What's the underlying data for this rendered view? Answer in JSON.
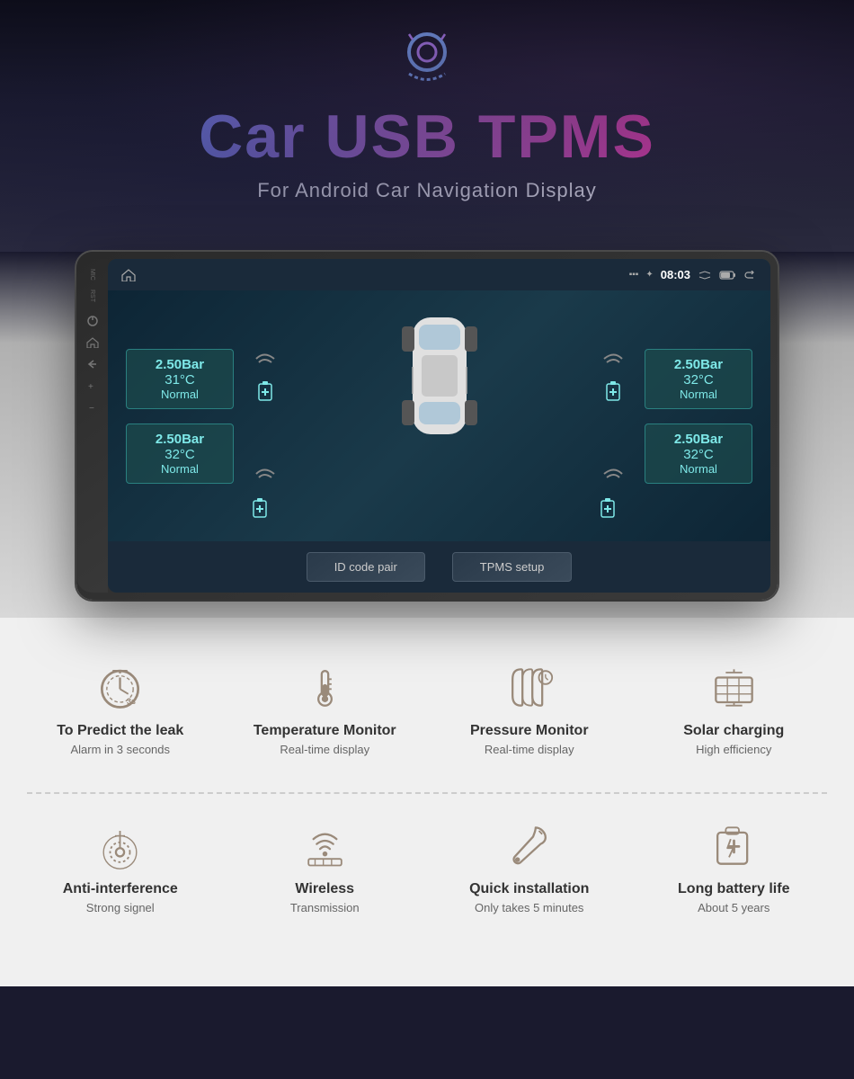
{
  "hero": {
    "icon": "⊙",
    "title": "Car USB TPMS",
    "subtitle": "For Android Car Navigation Display"
  },
  "device": {
    "topbar": {
      "left_label": "MIC",
      "rst_label": "RST",
      "time": "08:03",
      "icons": [
        "📶",
        "🔵",
        "⌃"
      ]
    },
    "tires": [
      {
        "pressure": "2.50Bar",
        "temp": "31°C",
        "status": "Normal"
      },
      {
        "pressure": "2.50Bar",
        "temp": "32°C",
        "status": "Normal"
      },
      {
        "pressure": "2.50Bar",
        "temp": "32°C",
        "status": "Normal"
      },
      {
        "pressure": "2.50Bar",
        "temp": "32°C",
        "status": "Normal"
      }
    ],
    "buttons": [
      {
        "label": "ID code pair"
      },
      {
        "label": "TPMS setup"
      }
    ]
  },
  "features_row1": [
    {
      "id": "predict-leak",
      "title": "To Predict the leak",
      "desc": "Alarm in 3 seconds",
      "icon_type": "timer"
    },
    {
      "id": "temperature",
      "title": "Temperature Monitor",
      "desc": "Real-time display",
      "icon_type": "thermometer"
    },
    {
      "id": "pressure",
      "title": "Pressure Monitor",
      "desc": "Real-time display",
      "icon_type": "pressure"
    },
    {
      "id": "solar",
      "title": "Solar charging",
      "desc": "High efficiency",
      "icon_type": "solar"
    }
  ],
  "features_row2": [
    {
      "id": "anti-interference",
      "title": "Anti-interference",
      "desc": "Strong signel",
      "icon_type": "signal"
    },
    {
      "id": "wireless",
      "title": "Wireless",
      "desc": "Transmission",
      "icon_type": "wireless"
    },
    {
      "id": "quick-install",
      "title": "Quick installation",
      "desc": "Only takes 5 minutes",
      "icon_type": "wrench"
    },
    {
      "id": "battery",
      "title": "Long battery life",
      "desc": "About 5 years",
      "icon_type": "battery"
    }
  ]
}
